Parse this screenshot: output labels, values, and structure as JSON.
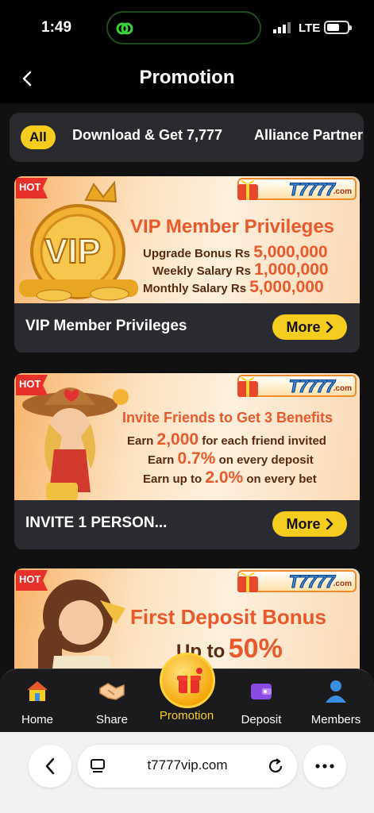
{
  "status_bar": {
    "time": "1:49",
    "network": "LTE"
  },
  "header": {
    "title": "Promotion"
  },
  "tabs": [
    {
      "label": "All",
      "active": true
    },
    {
      "label": "Download & Get 7,777",
      "active": false
    },
    {
      "label": "Alliance Partner",
      "active": false
    }
  ],
  "brand": {
    "name": "T7777",
    "domain": ".com"
  },
  "hot_label": "HOT",
  "cards": [
    {
      "banner": {
        "headline": "VIP Member Privileges",
        "badge_text": "VIP",
        "lines": [
          {
            "label": "Upgrade Bonus Rs",
            "value": "5,000,000"
          },
          {
            "label": "Weekly Salary Rs",
            "value": "1,000,000"
          },
          {
            "label": "Monthly Salary Rs",
            "value": "5,000,000"
          }
        ]
      },
      "title": "VIP Member Privileges",
      "more_label": "More"
    },
    {
      "banner": {
        "headline": "Invite Friends to Get 3 Benefits",
        "lines": [
          {
            "prefix": "Earn",
            "value": "2,000",
            "suffix": "for each friend invited"
          },
          {
            "prefix": "Earn",
            "value": "0.7%",
            "suffix": "on every deposit"
          },
          {
            "prefix": "Earn up to",
            "value": "2.0%",
            "suffix": "on every bet"
          }
        ]
      },
      "title": "INVITE 1 PERSON...",
      "more_label": "More"
    },
    {
      "banner": {
        "headline": "First Deposit Bonus",
        "sub_prefix": "Up to",
        "sub_value": "50%"
      }
    }
  ],
  "bottom_nav": [
    {
      "label": "Home",
      "icon": "home-icon",
      "active": false
    },
    {
      "label": "Share",
      "icon": "handshake-icon",
      "active": false
    },
    {
      "label": "Promotion",
      "icon": "gift-icon",
      "active": true
    },
    {
      "label": "Deposit",
      "icon": "wallet-icon",
      "active": false
    },
    {
      "label": "Members",
      "icon": "person-icon",
      "active": false
    }
  ],
  "browser": {
    "url": "t7777vip.com"
  },
  "colors": {
    "accent": "#f5cd1e",
    "card_bg": "#2a2b31",
    "headline_orange": "#e8592b"
  }
}
